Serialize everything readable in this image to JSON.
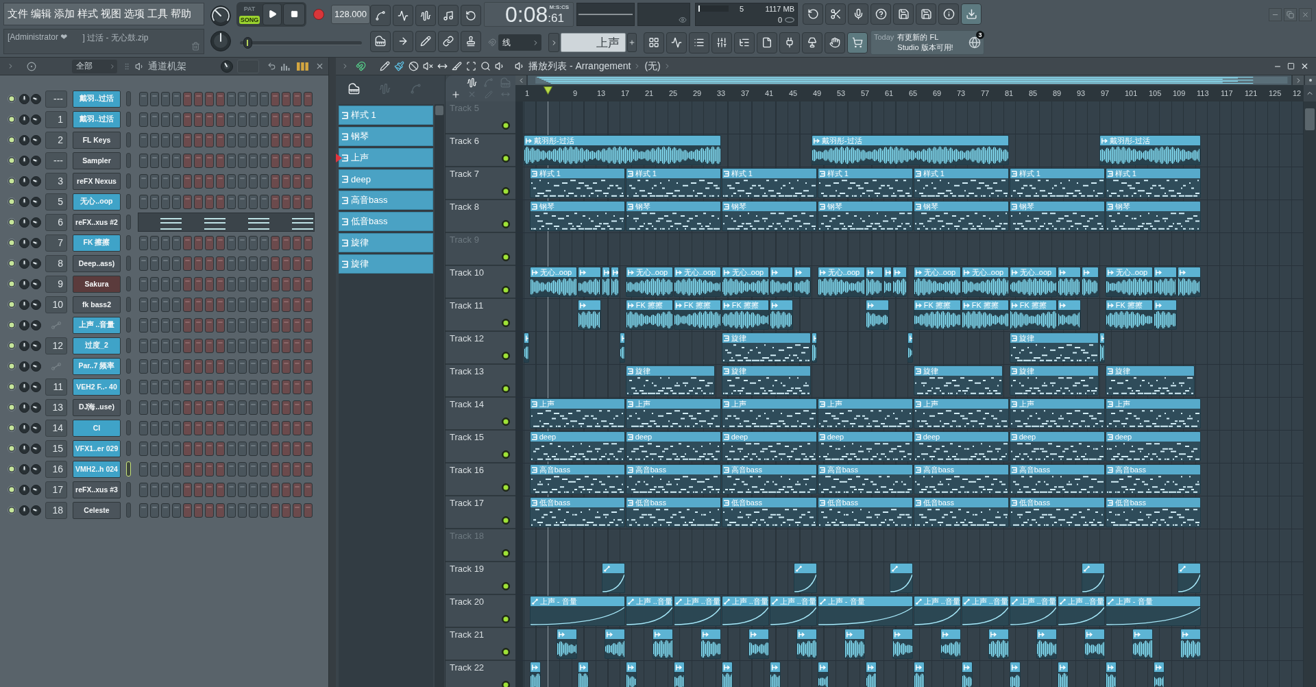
{
  "menu": [
    "文件",
    "编辑",
    "添加",
    "样式",
    "视图",
    "选项",
    "工具",
    "帮助"
  ],
  "hint_bar": {
    "user": "[Administrator ❤",
    "project": "] 过活 - 无心鼓.zip"
  },
  "transport": {
    "modes": [
      {
        "label": "PAT",
        "selected": false
      },
      {
        "label": "SONG",
        "selected": true
      }
    ],
    "tempo": "128.000"
  },
  "song_position": {
    "level": 0.03
  },
  "time": {
    "main": "0:08",
    "fraction": ":61",
    "format": "M:S:CS"
  },
  "monitor": {
    "cpu_meter": {
      "level": 0.04
    },
    "readout_1": "5",
    "memory": "1117 MB",
    "readout_2": "0"
  },
  "snap": "线",
  "pattern_selector": "上声",
  "news": {
    "label": "Today",
    "text": "有更新的 FL Studio 版本可用!",
    "badge": "3"
  },
  "channel_rack": {
    "filter": "全部",
    "title": "通道机架",
    "channels": [
      {
        "kind": "steps",
        "mixer": "---",
        "name": "戴羽..过活",
        "color": "#3fa3c8",
        "selected": false
      },
      {
        "kind": "steps",
        "mixer": "1",
        "name": "戴羽..过活",
        "color": "#3fa3c8",
        "selected": false
      },
      {
        "kind": "steps",
        "mixer": "2",
        "name": "FL Keys",
        "color": "#4b545b",
        "selected": false
      },
      {
        "kind": "steps",
        "mixer": "---",
        "name": "Sampler",
        "color": "#4b545b",
        "selected": false
      },
      {
        "kind": "steps",
        "mixer": "3",
        "name": "reFX Nexus",
        "color": "#4b545b",
        "selected": false
      },
      {
        "kind": "steps",
        "mixer": "5",
        "name": "无心..oop",
        "color": "#3fa3c8",
        "selected": false
      },
      {
        "kind": "piano_roll",
        "mixer": "6",
        "name": "reFX..xus #2",
        "color": "#4b545b",
        "selected": false
      },
      {
        "kind": "steps",
        "mixer": "7",
        "name": "FK 擦擦",
        "color": "#3fa3c8",
        "selected": false
      },
      {
        "kind": "steps",
        "mixer": "8",
        "name": "Deep..ass)",
        "color": "#4b545b",
        "selected": false
      },
      {
        "kind": "steps",
        "mixer": "9",
        "name": "Sakura",
        "color": "#5b3b3c",
        "selected": false
      },
      {
        "kind": "steps",
        "mixer": "10",
        "name": "fk bass2",
        "color": "#4b545b",
        "selected": false
      },
      {
        "kind": "automation",
        "name": "上声 ..音量",
        "color": "#3fa3c8",
        "selected": false
      },
      {
        "kind": "steps",
        "mixer": "12",
        "name": "过度_2",
        "color": "#3fa3c8",
        "selected": false
      },
      {
        "kind": "automation",
        "name": "Par..7 频率",
        "color": "#3fa3c8",
        "selected": false
      },
      {
        "kind": "steps",
        "mixer": "11",
        "name": "VEH2 F..- 40",
        "color": "#3fa3c8",
        "selected": false
      },
      {
        "kind": "steps",
        "mixer": "13",
        "name": "DJ海..use)",
        "color": "#4b545b",
        "selected": false
      },
      {
        "kind": "steps",
        "mixer": "14",
        "name": "CI",
        "color": "#3fa3c8",
        "selected": false
      },
      {
        "kind": "steps",
        "mixer": "15",
        "name": "VFX1..er 029",
        "color": "#3fa3c8",
        "selected": false
      },
      {
        "kind": "steps",
        "mixer": "16",
        "name": "VMH2..h 024",
        "color": "#3fa3c8",
        "selected": true
      },
      {
        "kind": "steps",
        "mixer": "17",
        "name": "reFX..xus #3",
        "color": "#4b545b",
        "selected": false
      },
      {
        "kind": "steps",
        "mixer": "18",
        "name": "Celeste",
        "color": "#4b545b",
        "selected": false
      }
    ]
  },
  "playlist": {
    "title": "播放列表 - Arrangement",
    "arrangement": "(无)",
    "patterns": [
      {
        "name": "样式 1",
        "selected": false
      },
      {
        "name": "钢琴",
        "selected": false
      },
      {
        "name": "上声",
        "selected": true
      },
      {
        "name": "deep",
        "selected": false
      },
      {
        "name": "高音bass",
        "selected": false
      },
      {
        "name": "低音bass",
        "selected": false
      },
      {
        "name": "旋律",
        "selected": false
      },
      {
        "name": "旋律",
        "selected": false
      }
    ],
    "ruler": [
      "1",
      "9",
      "13",
      "17",
      "21",
      "25",
      "29",
      "33",
      "37",
      "41",
      "45",
      "49",
      "53",
      "57",
      "61",
      "65",
      "69",
      "73",
      "77",
      "81",
      "85",
      "89",
      "93",
      "97",
      "101",
      "105",
      "109",
      "113",
      "117",
      "121",
      "125",
      "12"
    ],
    "tracks": [
      {
        "name": "Track 5"
      },
      {
        "name": "Track 6",
        "clips": [
          {
            "kind": "audio",
            "label": "戴羽彤-过活"
          },
          {
            "kind": "audio",
            "label": "戴羽彤-过活"
          },
          {
            "kind": "audio",
            "label": "戴羽彤-过活"
          }
        ]
      },
      {
        "name": "Track 7",
        "clips": [
          {
            "kind": "pattern",
            "label": "样式 1"
          },
          {
            "kind": "pattern",
            "label": "样式 1"
          },
          {
            "kind": "pattern",
            "label": "样式 1"
          },
          {
            "kind": "pattern",
            "label": "样式 1"
          },
          {
            "kind": "pattern",
            "label": "样式 1"
          },
          {
            "kind": "pattern",
            "label": "样式 1"
          },
          {
            "kind": "pattern",
            "label": "样式 1"
          }
        ]
      },
      {
        "name": "Track 8",
        "clips": [
          {
            "kind": "pattern",
            "label": "钢琴"
          },
          {
            "kind": "pattern",
            "label": "钢琴"
          },
          {
            "kind": "pattern",
            "label": "钢琴"
          },
          {
            "kind": "pattern",
            "label": "钢琴"
          },
          {
            "kind": "pattern",
            "label": "钢琴"
          },
          {
            "kind": "pattern",
            "label": "钢琴"
          },
          {
            "kind": "pattern",
            "label": "钢琴"
          }
        ]
      },
      {
        "name": "Track 9"
      },
      {
        "name": "Track 10",
        "clips": [
          {
            "kind": "audio",
            "label": "无心..oop"
          },
          {
            "kind": "audio"
          },
          {
            "kind": "audio"
          },
          {
            "kind": "audio"
          },
          {
            "kind": "audio",
            "label": "无心..oop"
          },
          {
            "kind": "audio",
            "label": "无心..oop"
          },
          {
            "kind": "audio",
            "label": "无心..oop"
          },
          {
            "kind": "audio"
          },
          {
            "kind": "audio"
          },
          {
            "kind": "audio",
            "label": "无心..oop"
          },
          {
            "kind": "audio"
          },
          {
            "kind": "audio"
          },
          {
            "kind": "audio"
          },
          {
            "kind": "audio",
            "label": "无心..oop"
          },
          {
            "kind": "audio",
            "label": "无心..oop"
          },
          {
            "kind": "audio",
            "label": "无心..oop"
          },
          {
            "kind": "audio"
          },
          {
            "kind": "audio"
          },
          {
            "kind": "audio",
            "label": "无心..oop"
          },
          {
            "kind": "audio"
          },
          {
            "kind": "audio"
          }
        ]
      },
      {
        "name": "Track 11",
        "clips": [
          {
            "kind": "audio"
          },
          {
            "kind": "audio",
            "label": "FK 擦擦"
          },
          {
            "kind": "audio",
            "label": "FK 擦擦"
          },
          {
            "kind": "audio",
            "label": "FK 擦擦"
          },
          {
            "kind": "audio"
          },
          {
            "kind": "audio"
          },
          {
            "kind": "audio",
            "label": "FK 擦擦"
          },
          {
            "kind": "audio",
            "label": "FK 擦擦"
          },
          {
            "kind": "audio",
            "label": "FK 擦擦"
          },
          {
            "kind": "audio"
          },
          {
            "kind": "audio",
            "label": "FK 擦擦"
          },
          {
            "kind": "audio"
          }
        ]
      },
      {
        "name": "Track 12",
        "clips": [
          {
            "kind": "audio"
          },
          {
            "kind": "audio"
          },
          {
            "kind": "pattern",
            "label": "旋律"
          },
          {
            "kind": "audio"
          },
          {
            "kind": "audio"
          },
          {
            "kind": "pattern",
            "label": "旋律"
          },
          {
            "kind": "audio"
          }
        ]
      },
      {
        "name": "Track 13",
        "clips": [
          {
            "kind": "pattern",
            "label": "旋律"
          },
          {
            "kind": "pattern",
            "label": "旋律"
          },
          {
            "kind": "pattern",
            "label": "旋律"
          },
          {
            "kind": "pattern",
            "label": "旋律"
          },
          {
            "kind": "pattern",
            "label": "旋律"
          }
        ]
      },
      {
        "name": "Track 14",
        "clips": [
          {
            "kind": "pattern",
            "label": "上声"
          },
          {
            "kind": "pattern",
            "label": "上声"
          },
          {
            "kind": "pattern",
            "label": "上声"
          },
          {
            "kind": "pattern",
            "label": "上声"
          },
          {
            "kind": "pattern",
            "label": "上声"
          },
          {
            "kind": "pattern",
            "label": "上声"
          },
          {
            "kind": "pattern",
            "label": "上声"
          }
        ]
      },
      {
        "name": "Track 15",
        "clips": [
          {
            "kind": "pattern",
            "label": "deep"
          },
          {
            "kind": "pattern",
            "label": "deep"
          },
          {
            "kind": "pattern",
            "label": "deep"
          },
          {
            "kind": "pattern",
            "label": "deep"
          },
          {
            "kind": "pattern",
            "label": "deep"
          },
          {
            "kind": "pattern",
            "label": "deep"
          },
          {
            "kind": "pattern",
            "label": "deep"
          }
        ]
      },
      {
        "name": "Track 16",
        "clips": [
          {
            "kind": "pattern",
            "label": "高音bass"
          },
          {
            "kind": "pattern",
            "label": "高音bass"
          },
          {
            "kind": "pattern",
            "label": "高音bass"
          },
          {
            "kind": "pattern",
            "label": "高音bass"
          },
          {
            "kind": "pattern",
            "label": "高音bass"
          },
          {
            "kind": "pattern",
            "label": "高音bass"
          },
          {
            "kind": "pattern",
            "label": "高音bass"
          }
        ]
      },
      {
        "name": "Track 17",
        "clips": [
          {
            "kind": "pattern",
            "label": "低音bass"
          },
          {
            "kind": "pattern",
            "label": "低音bass"
          },
          {
            "kind": "pattern",
            "label": "低音bass"
          },
          {
            "kind": "pattern",
            "label": "低音bass"
          },
          {
            "kind": "pattern",
            "label": "低音bass"
          },
          {
            "kind": "pattern",
            "label": "低音bass"
          },
          {
            "kind": "pattern",
            "label": "低音bass"
          }
        ]
      },
      {
        "name": "Track 18"
      },
      {
        "name": "Track 19",
        "clips": [
          {
            "kind": "automation"
          },
          {
            "kind": "automation"
          },
          {
            "kind": "automation"
          },
          {
            "kind": "automation"
          },
          {
            "kind": "automation"
          }
        ]
      },
      {
        "name": "Track 20",
        "clips": [
          {
            "kind": "automation",
            "label": "上声 - 音量"
          },
          {
            "kind": "automation",
            "label": "上声 ..音量"
          },
          {
            "kind": "automation",
            "label": "上声 ..音量"
          },
          {
            "kind": "automation",
            "label": "上声 ..音量"
          },
          {
            "kind": "automation",
            "label": "上声 ..音量"
          },
          {
            "kind": "automation",
            "label": "上声 - 音量"
          },
          {
            "kind": "automation",
            "label": "上声 ..音量"
          },
          {
            "kind": "automation",
            "label": "上声 ..音量"
          },
          {
            "kind": "automation",
            "label": "上声 ..音量"
          },
          {
            "kind": "automation",
            "label": "上声 ..音量"
          },
          {
            "kind": "automation",
            "label": "上声 - 音量"
          }
        ]
      },
      {
        "name": "Track 21",
        "clips": [
          {
            "kind": "audio"
          },
          {
            "kind": "audio"
          },
          {
            "kind": "audio"
          },
          {
            "kind": "audio"
          },
          {
            "kind": "audio"
          },
          {
            "kind": "audio"
          },
          {
            "kind": "audio"
          },
          {
            "kind": "audio"
          },
          {
            "kind": "audio"
          },
          {
            "kind": "audio"
          },
          {
            "kind": "audio"
          },
          {
            "kind": "audio"
          },
          {
            "kind": "audio"
          },
          {
            "kind": "audio"
          }
        ]
      },
      {
        "name": "Track 22",
        "clips": [
          {
            "kind": "audio"
          },
          {
            "kind": "audio"
          },
          {
            "kind": "audio"
          },
          {
            "kind": "audio"
          },
          {
            "kind": "audio"
          },
          {
            "kind": "audio"
          },
          {
            "kind": "audio"
          },
          {
            "kind": "audio"
          },
          {
            "kind": "audio"
          },
          {
            "kind": "audio"
          },
          {
            "kind": "audio"
          },
          {
            "kind": "audio"
          },
          {
            "kind": "audio"
          },
          {
            "kind": "audio"
          }
        ]
      }
    ]
  }
}
